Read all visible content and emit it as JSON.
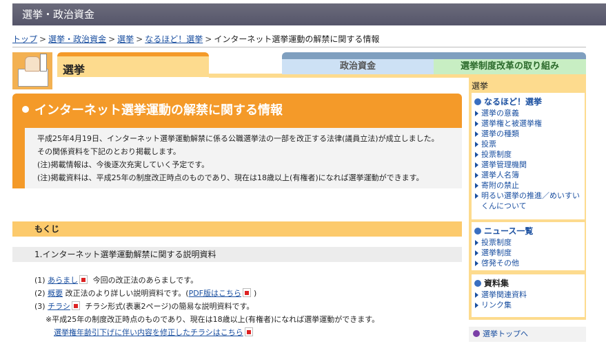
{
  "header": {
    "title": "選挙・政治資金"
  },
  "breadcrumb": {
    "links": [
      "トップ",
      "選挙・政治資金",
      "選挙",
      "なるほど！選挙"
    ],
    "separator": ">",
    "current": "インターネット選挙運動の解禁に関する情報"
  },
  "tabs": {
    "active": "選挙",
    "seiji": "政治資金",
    "kaikaku": "選挙制度改革の取り組み"
  },
  "main": {
    "title": "インターネット選挙運動の解禁に関する情報",
    "intro": [
      "平成25年4月19日、インターネット選挙運動解禁に係る公職選挙法の一部を改正する法律(議員立法)が成立しました。",
      "その関係資料を下記のとおり掲載します。",
      "(注)掲載情報は、今後逐次充実していく予定です。",
      "(注)掲載資料は、平成25年の制度改正時点のものであり、現在は18歳以上(有権者)になれば選挙運動ができます。"
    ],
    "mokuji": "もくじ",
    "section": "1.インターネット選挙運動解禁に関する説明資料",
    "items": [
      {
        "num": "(1)",
        "link": "あらまし",
        "text": "今回の改正法のあらましです。"
      },
      {
        "num": "(2)",
        "link": "概要",
        "text": "改正法のより詳しい説明資料です。(",
        "link2": "PDF版はこちら",
        "text2": ")"
      },
      {
        "num": "(3)",
        "link": "チラシ",
        "text": "チラシ形式(表裏2ページ)の簡易な説明資料です。"
      }
    ],
    "note": "※平成25年の制度改正時点のものであり、現在は18歳以上(有権者)になれば選挙運動ができます。",
    "correction_link": "選挙権年齢引下げに伴い内容を修正したチラシはこちら"
  },
  "sidebar": {
    "header": "選挙",
    "group1": {
      "title": "なるほど！選挙",
      "items": [
        "選挙の意義",
        "選挙権と被選挙権",
        "選挙の種類",
        "投票",
        "投票制度",
        "選挙管理機関",
        "選挙人名簿",
        "寄附の禁止",
        "明るい選挙の推進／めいすいくんについて"
      ]
    },
    "group2": {
      "title": "ニュース一覧",
      "items": [
        "投票制度",
        "選挙制度",
        "啓発その他"
      ]
    },
    "group3": {
      "title": "資料集",
      "items": [
        "選挙関連資料",
        "リンク集"
      ]
    },
    "top_link": "選挙トップへ"
  }
}
